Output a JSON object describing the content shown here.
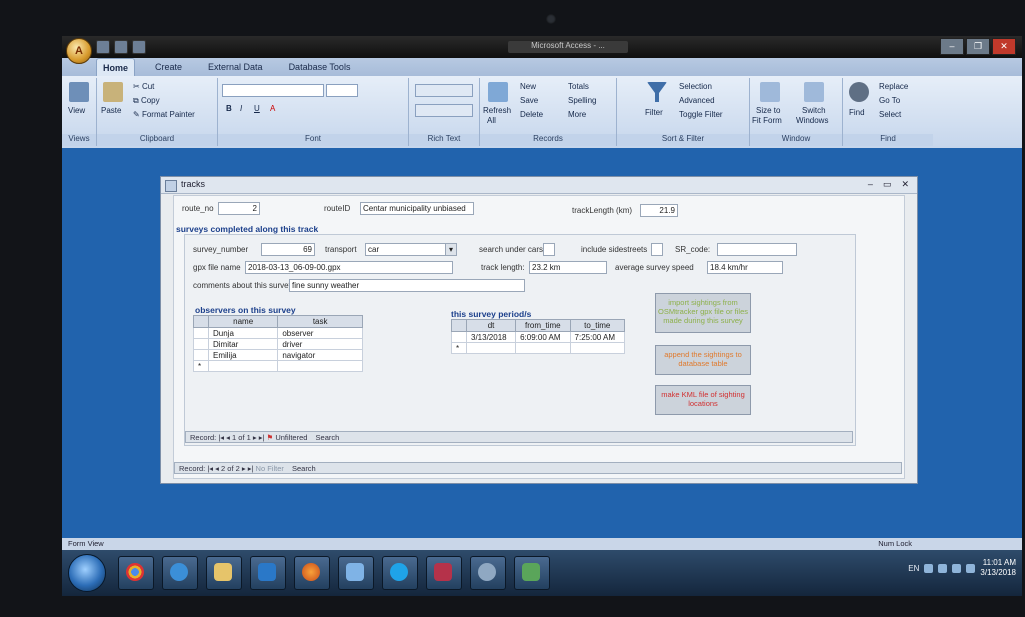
{
  "app": {
    "window_title": "Microsoft Access - ..."
  },
  "ribbon": {
    "tabs": [
      "Home",
      "Create",
      "External Data",
      "Database Tools"
    ],
    "views": {
      "view": "View",
      "group": "Views"
    },
    "clipboard": {
      "paste": "Paste",
      "cut": "Cut",
      "copy": "Copy",
      "format_painter": "Format Painter",
      "group": "Clipboard"
    },
    "font": {
      "bold": "B",
      "italic": "I",
      "underline": "U",
      "font_color": "A",
      "group": "Font"
    },
    "rich_text": {
      "group": "Rich Text"
    },
    "records": {
      "refresh": "Refresh",
      "refresh_sub": "All",
      "new": "New",
      "save": "Save",
      "delete": "Delete",
      "totals": "Totals",
      "spelling": "Spelling",
      "more": "More",
      "group": "Records"
    },
    "sort_filter": {
      "filter": "Filter",
      "selection": "Selection",
      "advanced": "Advanced",
      "toggle_filter": "Toggle Filter",
      "group": "Sort & Filter"
    },
    "window": {
      "size_to_fit": "Size to",
      "size_to_fit2": "Fit Form",
      "switch": "Switch",
      "switch2": "Windows",
      "group": "Window"
    },
    "find": {
      "find": "Find",
      "replace": "Replace",
      "goto": "Go To",
      "select": "Select",
      "group": "Find"
    }
  },
  "form": {
    "title": "tracks",
    "route_no_label": "route_no",
    "route_no_value": "2",
    "route_id_label": "routeID",
    "route_id_value": "Centar municipality unbiased",
    "track_length_label": "trackLength (km)",
    "track_length_value": "21.9",
    "surveys_title": "surveys completed along this track",
    "survey": {
      "survey_number_label": "survey_number",
      "survey_number_value": "69",
      "transport_label": "transport",
      "transport_value": "car",
      "search_under_cars_label": "search under cars",
      "include_sidestreets_label": "include sidestreets",
      "sr_code_label": "SR_code:",
      "sr_code_value": "",
      "gpx_label": "gpx file name",
      "gpx_value": "2018-03-13_06-09-00.gpx",
      "track_length_label": "track length:",
      "track_length_value": "23.2 km",
      "avg_speed_label": "average survey speed",
      "avg_speed_value": "18.4 km/hr",
      "comments_label": "comments about this survey",
      "comments_value": "fine sunny weather",
      "observers_title": "observers on this survey",
      "observers_headers": [
        "name",
        "task"
      ],
      "observers": [
        {
          "name": "Dunja",
          "task": "observer"
        },
        {
          "name": "Dimitar",
          "task": "driver"
        },
        {
          "name": "Emilija",
          "task": "navigator"
        }
      ],
      "period_title": "this survey period/s",
      "period_headers": [
        "dt",
        "from_time",
        "to_time"
      ],
      "periods": [
        {
          "dt": "3/13/2018",
          "from_time": "6:09:00 AM",
          "to_time": "7:25:00 AM"
        }
      ],
      "import_button": "import sightings from OSMtracker gpx file or files made during this survey",
      "append_button": "append the sightings to database table",
      "kml_button": "make KML file of sighting locations",
      "sub_nav": {
        "record": "Record:",
        "position": "1 of 1",
        "filter": "Unfiltered",
        "search": "Search"
      }
    },
    "main_nav": {
      "record": "Record:",
      "position": "2 of 2",
      "filter": "No Filter",
      "search": "Search"
    }
  },
  "status": {
    "left": "Form View",
    "right": "Num Lock"
  },
  "taskbar": {
    "lang": "EN",
    "time": "11:01 AM",
    "date": "3/13/2018"
  },
  "colors": {
    "workspace": "#2163ad",
    "section_title": "#1b3f8b",
    "import_text": "#8db04a",
    "append_text": "#e07a2d",
    "kml_text": "#d13030"
  }
}
